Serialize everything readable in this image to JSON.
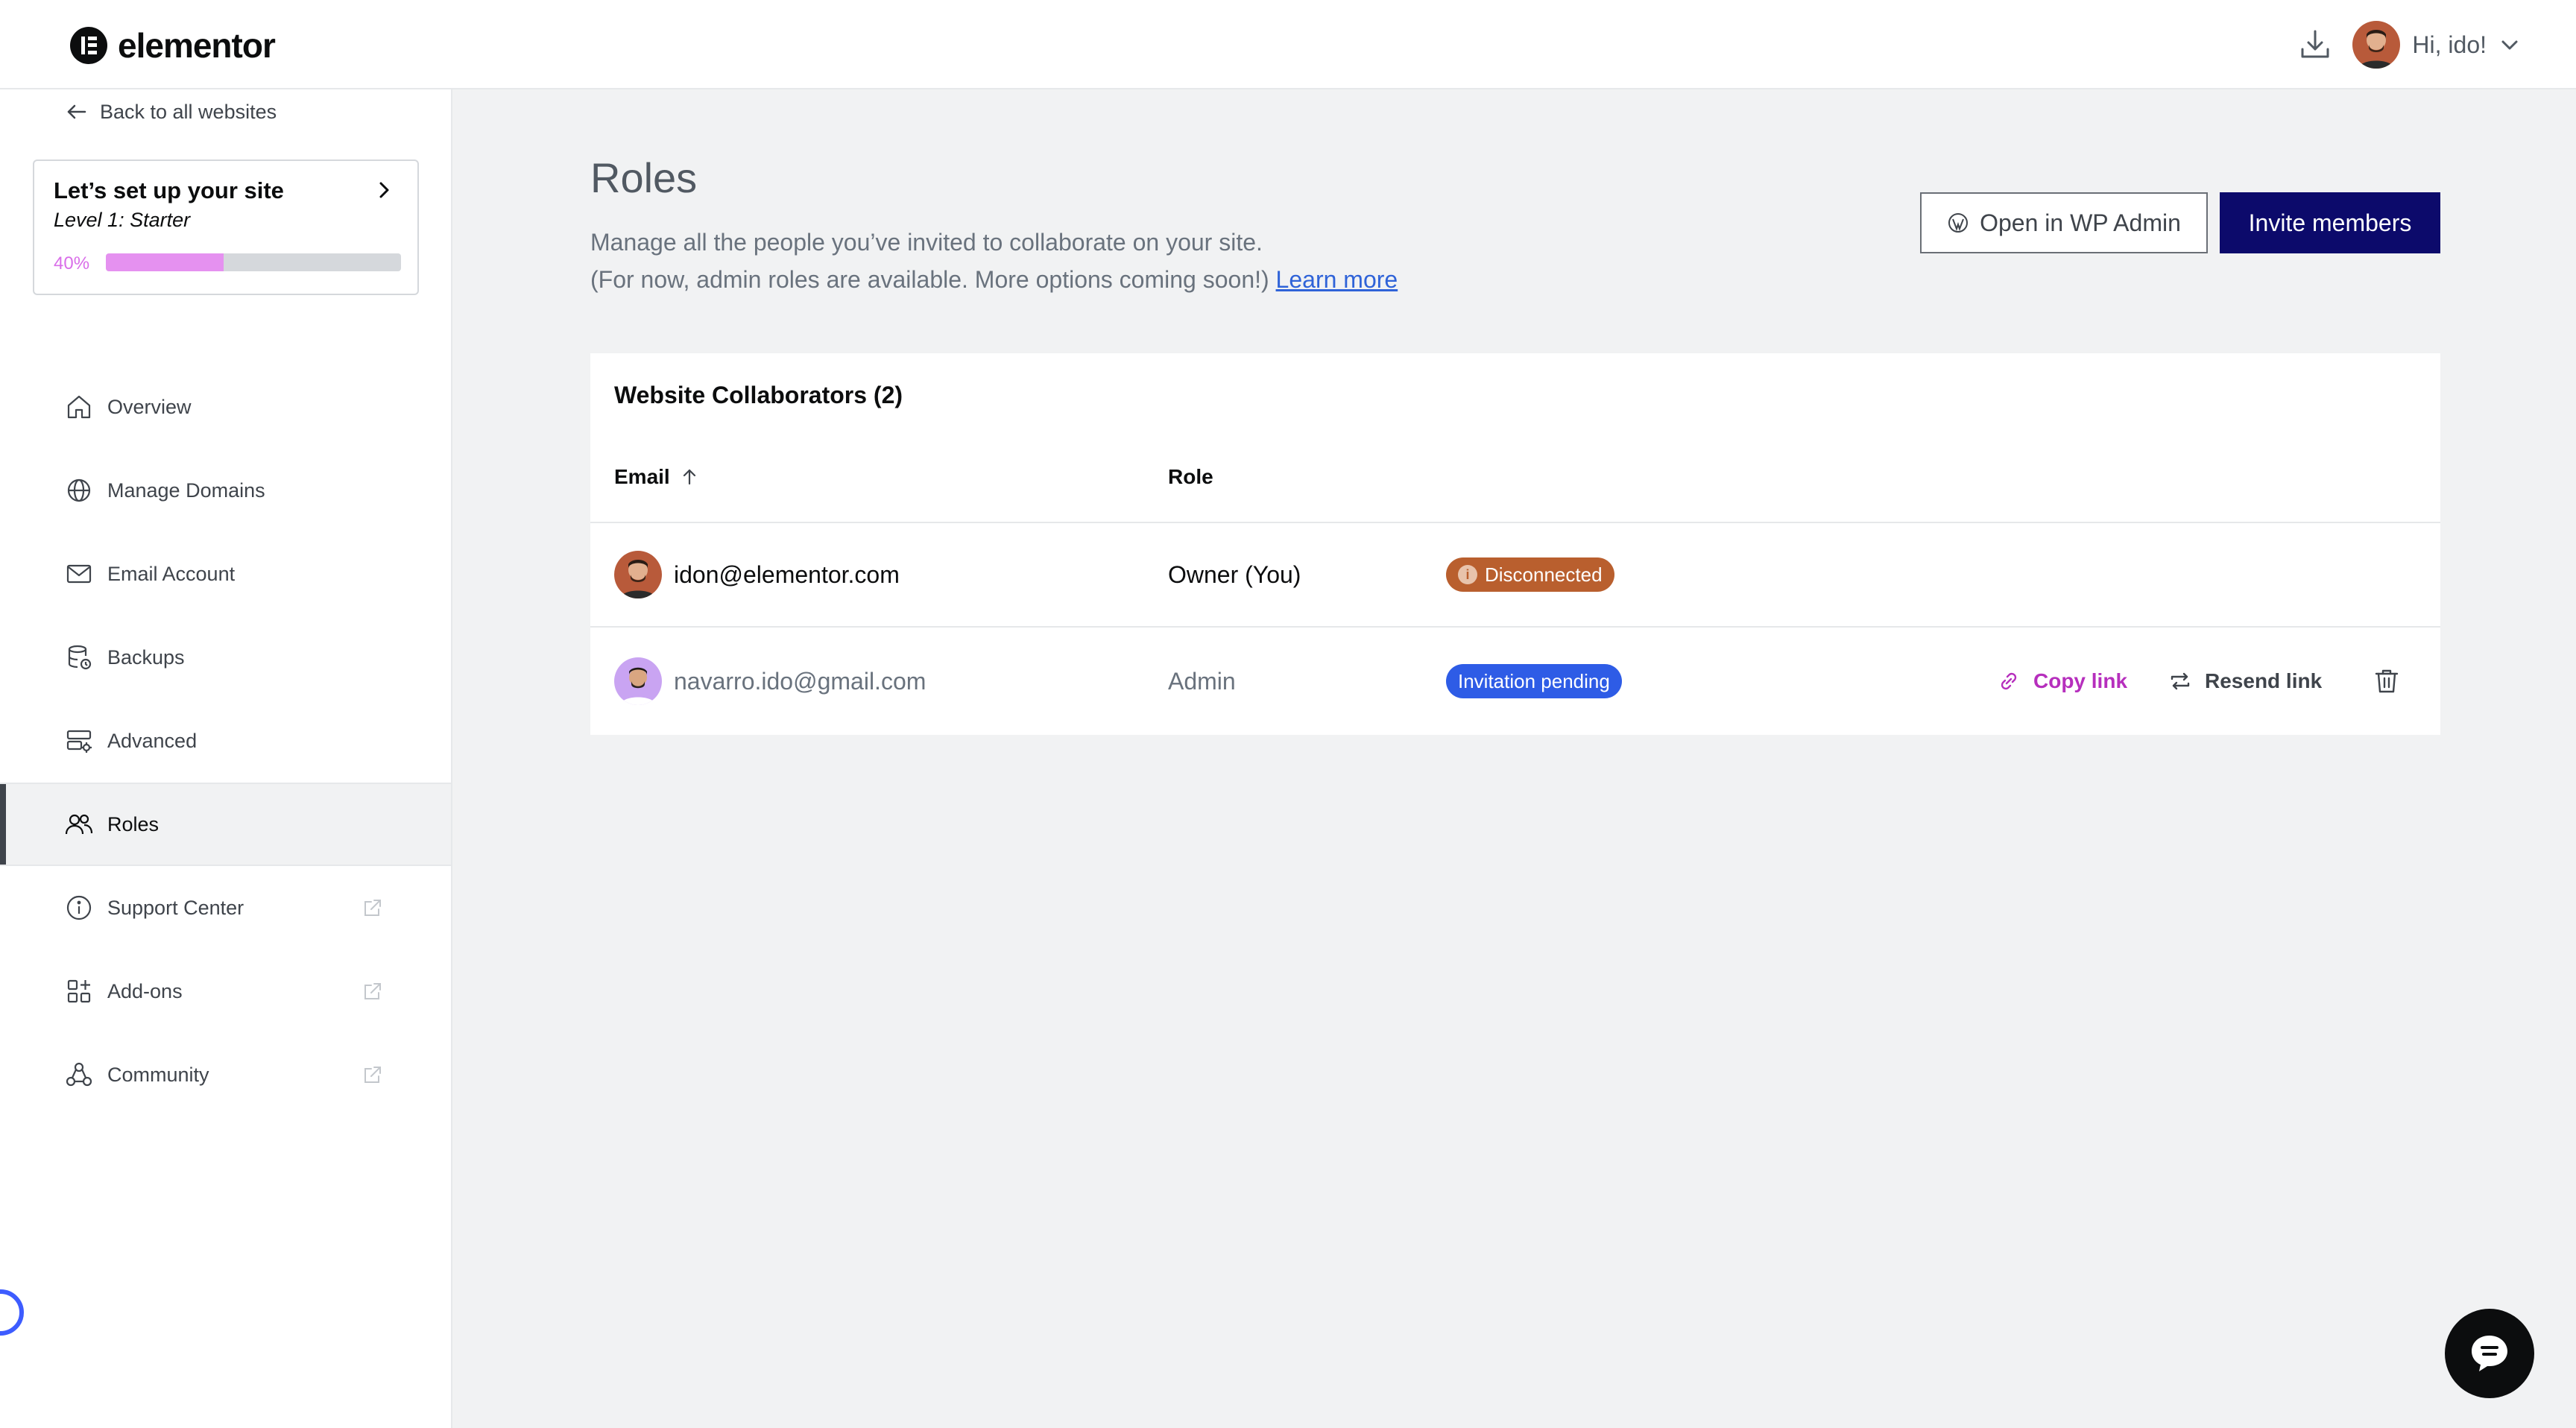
{
  "header": {
    "brand": "elementor",
    "greeting": "Hi, ido!",
    "icons": {
      "download": "download-icon",
      "user_menu": "chevron-down-icon"
    }
  },
  "sidebar": {
    "back_label": "Back to all websites",
    "setup": {
      "title": "Let’s set up your site",
      "level": "Level 1: Starter",
      "progress_label": "40%",
      "progress": 0.4
    },
    "items": [
      {
        "label": "Overview",
        "icon": "home-icon"
      },
      {
        "label": "Manage Domains",
        "icon": "globe-icon"
      },
      {
        "label": "Email Account",
        "icon": "mail-icon"
      },
      {
        "label": "Backups",
        "icon": "backup-icon"
      },
      {
        "label": "Advanced",
        "icon": "advanced-icon"
      },
      {
        "label": "Roles",
        "icon": "users-icon",
        "active": true
      },
      {
        "label": "Support Center",
        "icon": "info-icon",
        "external": true
      },
      {
        "label": "Add-ons",
        "icon": "addons-icon",
        "external": true
      },
      {
        "label": "Community",
        "icon": "community-icon",
        "external": true
      }
    ]
  },
  "main": {
    "title": "Roles",
    "description_line1": "Manage all the people you’ve invited to collaborate on your site.",
    "description_line2": "(For now, admin roles are available. More options coming soon!)",
    "learn_more": "Learn more",
    "open_wp_admin": "Open in WP Admin",
    "invite_members": "Invite members",
    "table": {
      "title": "Website Collaborators (2)",
      "col_email": "Email",
      "col_role": "Role",
      "rows": [
        {
          "email": "idon@elementor.com",
          "role": "Owner (You)",
          "status": "Disconnected",
          "status_color": "#b95f2e"
        },
        {
          "email": "navarro.ido@gmail.com",
          "role": "Admin",
          "status": "Invitation pending",
          "status_color": "#2e5ce6",
          "copy_link": "Copy link",
          "resend_link": "Resend link"
        }
      ]
    }
  },
  "colors": {
    "accent": "#0c0a6b",
    "link": "#2f63d8",
    "copy_link": "#b62fbd"
  }
}
